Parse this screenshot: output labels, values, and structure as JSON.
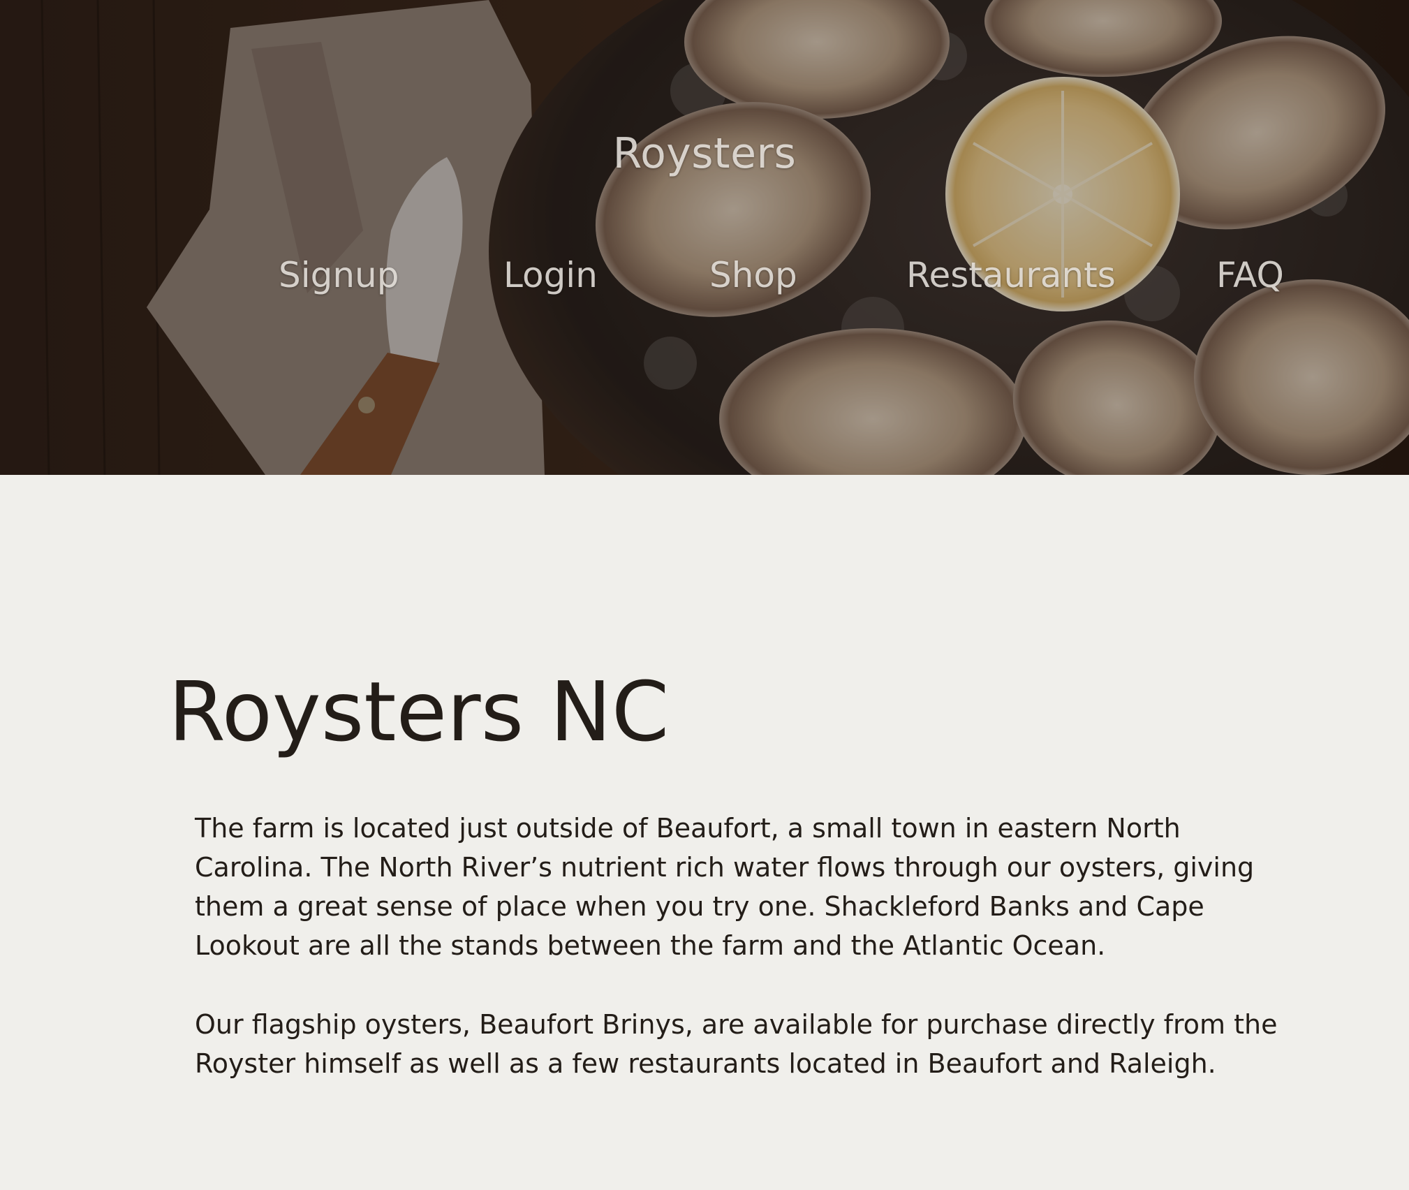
{
  "header": {
    "brand": "Roysters",
    "nav": {
      "signup": "Signup",
      "login": "Login",
      "shop": "Shop",
      "restaurants": "Restaurants",
      "faq": "FAQ"
    }
  },
  "main": {
    "title": "Roysters NC",
    "paragraphs": [
      "The farm is located just outside of Beaufort, a small town in eastern North Carolina. The North River’s nutrient rich water flows through our oysters, giving them a great sense of place when you try one. Shackleford Banks and Cape Lookout are all the stands between the farm and the Atlantic Ocean.",
      "Our flagship oysters, Beaufort Brinys, are available for purchase directly from the Royster himself as well as a few restaurants located in Beaufort and Raleigh."
    ]
  },
  "colors": {
    "page_background": "#f0efeb",
    "text": "#231d18",
    "nav_text": "#ece8e2"
  }
}
